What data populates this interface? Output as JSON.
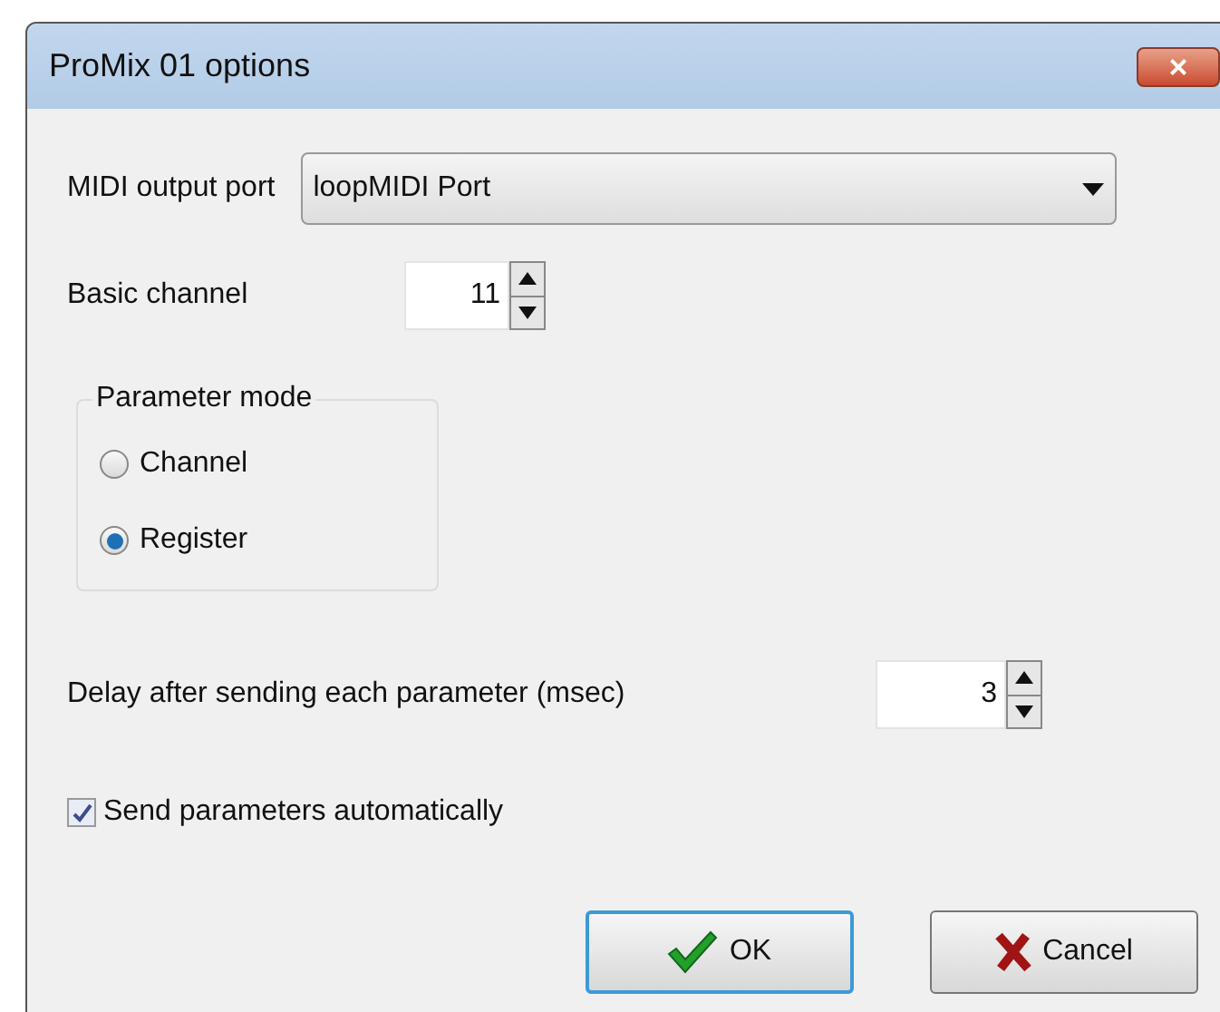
{
  "window": {
    "title": "ProMix 01 options",
    "close": "×"
  },
  "midi_output_port": {
    "label": "MIDI output port",
    "value": "loopMIDI Port"
  },
  "basic_channel": {
    "label": "Basic channel",
    "value": "11"
  },
  "parameter_mode": {
    "label": "Parameter mode",
    "options": [
      {
        "label": "Channel",
        "selected": false
      },
      {
        "label": "Register",
        "selected": true
      }
    ]
  },
  "delay": {
    "label": "Delay after sending each parameter (msec)",
    "value": "3"
  },
  "send_automatically": {
    "label": "Send parameters automatically",
    "checked": true
  },
  "buttons": [
    {
      "kind": "ok",
      "label": "OK",
      "focused": true
    },
    {
      "kind": "cancel",
      "label": "Cancel",
      "focused": false
    }
  ]
}
